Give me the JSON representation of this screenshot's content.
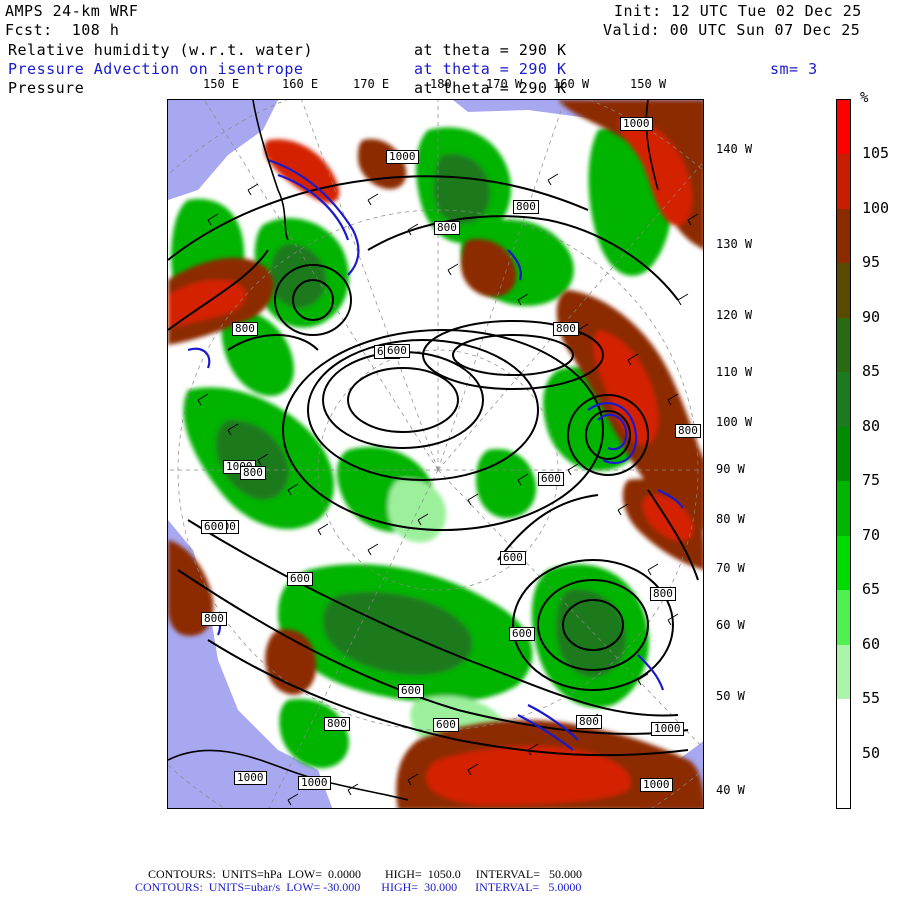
{
  "header": {
    "model": "AMPS 24-km WRF",
    "forecast": "Fcst:  108 h",
    "init": "Init: 12 UTC Tue 02 Dec 25",
    "valid": "Valid: 00 UTC Sun 07 Dec 25",
    "field1": "Relative humidity (w.r.t. water)",
    "field1_level": "at theta = 290 K",
    "field2": "Pressure Advection on isentrope",
    "field2_level": "at theta = 290 K",
    "field2_smoothing": "sm= 3",
    "field3": "Pressure",
    "field3_level": "at theta = 290 K"
  },
  "map": {
    "top_lon_labels": [
      "150 E",
      "160 E",
      "170 E",
      "180",
      "170 W",
      "160 W",
      "150 W"
    ],
    "right_lon_labels": [
      "140 W",
      "130 W",
      "120 W",
      "110 W",
      "100 W",
      "90 W",
      "80 W",
      "70 W",
      "60 W",
      "50 W",
      "40 W"
    ],
    "contour_labels": [
      "1000",
      "1000",
      "800",
      "800",
      "800",
      "800",
      "600",
      "800",
      "600",
      "1000",
      "800",
      "600",
      "600",
      "600",
      "600",
      "600",
      "800",
      "800",
      "600",
      "800",
      "600",
      "800",
      "800",
      "1000",
      "1000",
      "1000",
      "1000"
    ],
    "colors": {
      "ocean": "#a8a8f0",
      "dry": "#ffffff",
      "rh_green_light": "#9cf09c",
      "rh_green": "#00b400",
      "rh_green_dark": "#1e7a1e",
      "rh_olive": "#5a4a00",
      "rh_brown": "#8c2a00",
      "rh_red": "#d42000",
      "advection_contour": "#1a1acc",
      "pressure_contour": "#000000"
    }
  },
  "colorbar": {
    "unit": "%",
    "ticks": [
      "105",
      "100",
      "95",
      "90",
      "85",
      "80",
      "75",
      "70",
      "65",
      "60",
      "55",
      "50"
    ],
    "colors": [
      "#ff0000",
      "#c81e00",
      "#8c2a00",
      "#5a4a00",
      "#2a6a10",
      "#1e7a1e",
      "#008c00",
      "#00b400",
      "#00dc00",
      "#50f050",
      "#aaf5aa",
      "#ffffff",
      "#ffffff"
    ]
  },
  "footer": {
    "line1": "CONTOURS:  UNITS=hPa  LOW=  0.0000        HIGH=  1050.0     INTERVAL=   50.000",
    "line2": "CONTOURS:  UNITS=ubar/s  LOW= -30.000       HIGH=  30.000      INTERVAL=   5.0000"
  }
}
